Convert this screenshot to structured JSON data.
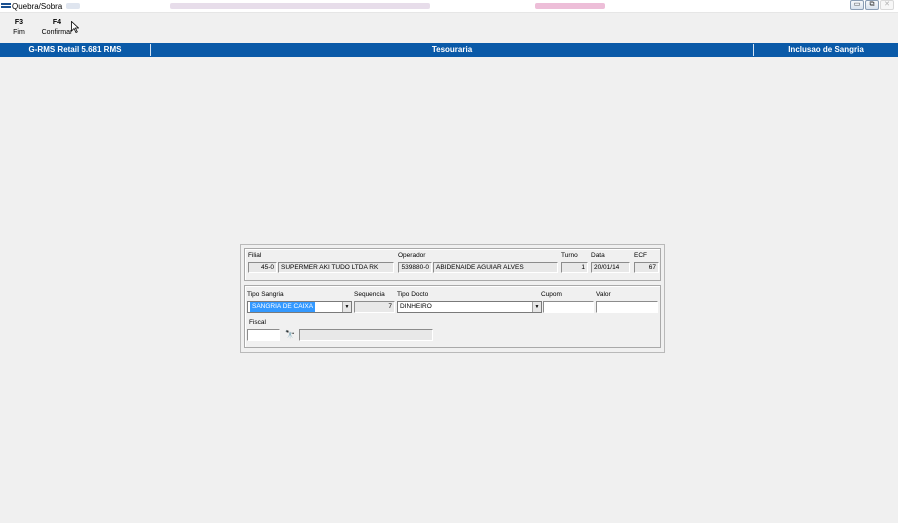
{
  "window": {
    "title": "Quebra/Sobra",
    "controls": {
      "minimize": "▭",
      "restore": "⧉",
      "close": "✕"
    }
  },
  "toolbar": {
    "items": [
      {
        "key": "F3",
        "label": "Fim"
      },
      {
        "key": "F4",
        "label": "Confirmar"
      }
    ]
  },
  "header": {
    "left": "G-RMS Retail 5.681 RMS",
    "center": "Tesouraria",
    "right": "Inclusao de Sangria"
  },
  "info": {
    "filial_label": "Filial",
    "filial_code": "45-0",
    "filial_name": "SUPERMER AKI TUDO LTDA RK",
    "operador_label": "Operador",
    "operador_code": "539880-0",
    "operador_name": "ABIDENAIDE AGUIAR ALVES",
    "turno_label": "Turno",
    "turno_value": "1",
    "data_label": "Data",
    "data_value": "20/01/14",
    "ecf_label": "ECF",
    "ecf_value": "67"
  },
  "form": {
    "tipo_sangria_label": "Tipo Sangria",
    "tipo_sangria_value": "SANGRIA DE CAIXA",
    "sequencia_label": "Sequencia",
    "sequencia_value": "7",
    "tipo_docto_label": "Tipo Docto",
    "tipo_docto_value": "DINHEIRO",
    "cupom_label": "Cupom",
    "cupom_value": "",
    "valor_label": "Valor",
    "valor_value": "",
    "fiscal_label": "Fiscal",
    "fiscal_value": "",
    "fiscal_name_value": ""
  },
  "icons": {
    "dropdown": "▼",
    "search": "🔭"
  },
  "colors": {
    "header_bg": "#0a5aa8",
    "selection": "#3399ff",
    "window_bg": "#f0f0f0"
  }
}
